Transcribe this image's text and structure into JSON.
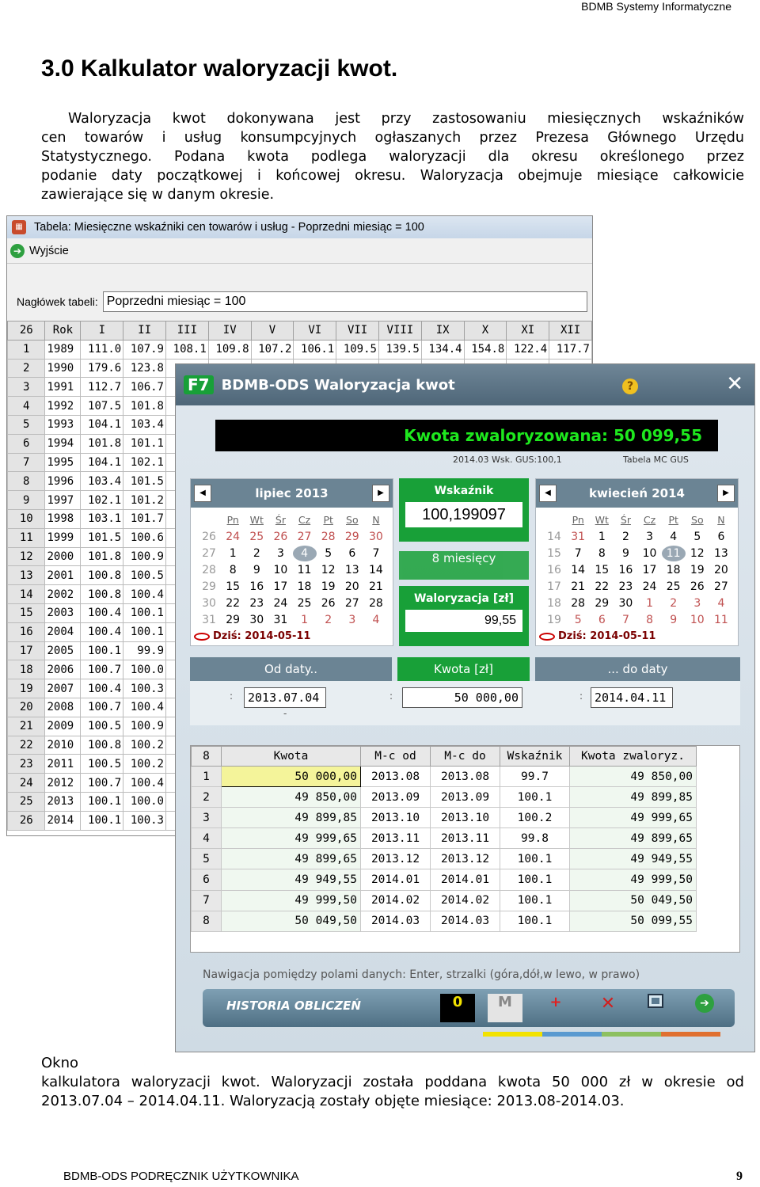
{
  "header": "BDMB Systemy Informatyczne",
  "heading": "3.0 Kalkulator waloryzacji kwot.",
  "intro": [
    "Waloryzacja kwot dokonywana jest przy zastosowaniu miesięcznych wskaźników",
    "cen towarów i usług konsumpcyjnych ogłaszanych przez Prezesa Głównego Urzędu",
    "Statystycznego. Podana kwota podlega waloryzacji dla okresu określonego przez",
    "podanie daty początkowej i końcowej okresu. Waloryzacja obejmuje miesiące całkowicie",
    "zawierające się w danym okresie."
  ],
  "back": {
    "title": "Tabela: Miesięczne wskaźniki cen towarów i usług - Poprzedni miesiąc = 100",
    "exit": "Wyjście",
    "header_label": "Nagłówek tabeli:",
    "header_value": "Poprzedni miesiąc = 100",
    "cols": [
      "26",
      "Rok",
      "I",
      "II",
      "III",
      "IV",
      "V",
      "VI",
      "VII",
      "VIII",
      "IX",
      "X",
      "XI",
      "XII"
    ],
    "years": [
      "1989",
      "1990",
      "1991",
      "1992",
      "1993",
      "1994",
      "1995",
      "1996",
      "1997",
      "1998",
      "1999",
      "2000",
      "2001",
      "2002",
      "2003",
      "2004",
      "2005",
      "2006",
      "2007",
      "2008",
      "2009",
      "2010",
      "2011",
      "2012",
      "2013",
      "2014"
    ],
    "jan": [
      "111.0",
      "179.6",
      "112.7",
      "107.5",
      "104.1",
      "101.8",
      "104.1",
      "103.4",
      "102.1",
      "103.1",
      "101.5",
      "101.8",
      "100.8",
      "100.8",
      "100.4",
      "100.4",
      "100.1",
      "100.7",
      "100.4",
      "100.7",
      "100.5",
      "100.8",
      "100.5",
      "100.7",
      "100.1",
      "100.1"
    ],
    "feb": [
      "107.9",
      "123.8",
      "106.7",
      "101.8",
      "103.4",
      "101.1",
      "102.1",
      "101.5",
      "101.2",
      "101.7",
      "100.6",
      "100.9",
      "100.5",
      "100.4",
      "100.1",
      "100.1",
      "99.9",
      "100.0",
      "100.3",
      "100.4",
      "100.9",
      "100.2",
      "100.2",
      "100.4",
      "100.0",
      "100.3"
    ],
    "row1_rest": [
      "108.1",
      "109.8",
      "107.2",
      "106.1",
      "109.5",
      "139.5",
      "134.4",
      "154.8",
      "122.4",
      "117.7"
    ]
  },
  "front": {
    "title": "BDMB-ODS  Waloryzacja kwot",
    "f7": "F7",
    "result": "Kwota zwaloryzowana: 50 099,55",
    "sub1": "2014.03   Wsk. GUS:100,1",
    "sub2": "Tabela MC GUS",
    "cal_left": {
      "month": "lipiec 2013",
      "today": "Dziś: 2014-05-11",
      "weeks": [
        "26",
        "27",
        "28",
        "29",
        "30",
        "31"
      ],
      "days": [
        "24",
        "25",
        "26",
        "27",
        "28",
        "29",
        "30",
        "1",
        "2",
        "3",
        "4",
        "5",
        "6",
        "7",
        "8",
        "9",
        "10",
        "11",
        "12",
        "13",
        "14",
        "15",
        "16",
        "17",
        "18",
        "19",
        "20",
        "21",
        "22",
        "23",
        "24",
        "25",
        "26",
        "27",
        "28",
        "29",
        "30",
        "31",
        "1",
        "2",
        "3",
        "4"
      ]
    },
    "cal_right": {
      "month": "kwiecień 2014",
      "today": "Dziś: 2014-05-11",
      "weeks": [
        "14",
        "15",
        "16",
        "17",
        "18",
        "19"
      ],
      "days": [
        "31",
        "1",
        "2",
        "3",
        "4",
        "5",
        "6",
        "7",
        "8",
        "9",
        "10",
        "11",
        "12",
        "13",
        "14",
        "15",
        "16",
        "17",
        "18",
        "19",
        "20",
        "21",
        "22",
        "23",
        "24",
        "25",
        "26",
        "27",
        "28",
        "29",
        "30",
        "1",
        "2",
        "3",
        "4",
        "5",
        "6",
        "7",
        "8",
        "9",
        "10",
        "11"
      ]
    },
    "dow": [
      "Pn",
      "Wt",
      "Śr",
      "Cz",
      "Pt",
      "So",
      "N"
    ],
    "wsk_label": "Wskaźnik",
    "wsk_value": "100,199097",
    "months": "8 miesięcy",
    "wal_label": "Waloryzacja [zł]",
    "wal_value": "99,55",
    "od_label": "Od daty..",
    "kwota_label": "Kwota  [zł]",
    "do_label": "... do daty",
    "od_value": "2013.07.04",
    "kwota_value": "50 000,00",
    "do_value": "2014.04.11",
    "colon": ":",
    "dash": "-",
    "table": {
      "headers": [
        "8",
        "Kwota",
        "M-c od",
        "M-c do",
        "Wskaźnik",
        "Kwota zwaloryz."
      ],
      "rows": [
        [
          "1",
          "50 000,00",
          "2013.08",
          "2013.08",
          "99.7",
          "49 850,00"
        ],
        [
          "2",
          "49 850,00",
          "2013.09",
          "2013.09",
          "100.1",
          "49 899,85"
        ],
        [
          "3",
          "49 899,85",
          "2013.10",
          "2013.10",
          "100.2",
          "49 999,65"
        ],
        [
          "4",
          "49 999,65",
          "2013.11",
          "2013.11",
          "99.8",
          "49 899,65"
        ],
        [
          "5",
          "49 899,65",
          "2013.12",
          "2013.12",
          "100.1",
          "49 949,55"
        ],
        [
          "6",
          "49 949,55",
          "2014.01",
          "2014.01",
          "100.1",
          "49 999,50"
        ],
        [
          "7",
          "49 999,50",
          "2014.02",
          "2014.02",
          "100.1",
          "50 049,50"
        ],
        [
          "8",
          "50 049,50",
          "2014.03",
          "2014.03",
          "100.1",
          "50 099,55"
        ]
      ]
    },
    "nav": "Nawigacja pomiędzy polami danych: Enter, strzalki  (góra,dół,w lewo, w prawo)",
    "history": "HISTORIA OBLICZEŃ",
    "btn0": "0",
    "btnM": "M",
    "btnPlus": "+",
    "btnX": "✕"
  },
  "caption": [
    "Okno",
    "kalkulatora waloryzacji kwot. Waloryzacji została poddana kwota 50 000 zł w okresie od",
    "2013.07.04 – 2014.04.11. Waloryzacją zostały objęte miesiące: 2013.08-2014.03."
  ],
  "footer": "BDMB-ODS PODRĘCZNIK UŻYTKOWNIKA",
  "page": "9"
}
